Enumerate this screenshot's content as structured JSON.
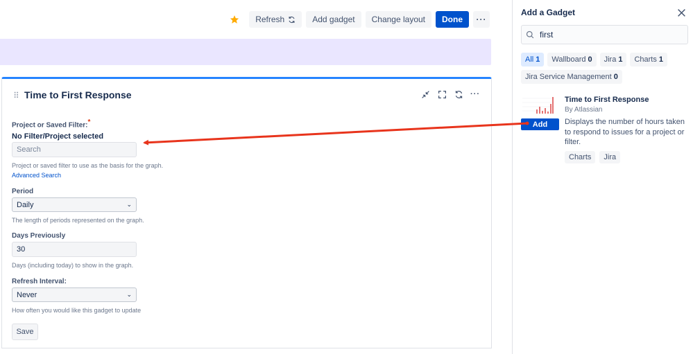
{
  "toolbar": {
    "refresh_label": "Refresh",
    "add_gadget_label": "Add gadget",
    "change_layout_label": "Change layout",
    "done_label": "Done",
    "more_label": "···"
  },
  "gadget": {
    "title": "Time to First Response",
    "form": {
      "project_label": "Project or Saved Filter:",
      "required_mark": "*",
      "no_filter_text": "No Filter/Project selected",
      "search_placeholder": "Search",
      "project_help": "Project or saved filter to use as the basis for the graph.",
      "advanced_search_link": "Advanced Search",
      "period_label": "Period",
      "period_value": "Daily",
      "period_help": "The length of periods represented on the graph.",
      "days_label": "Days Previously",
      "days_value": "30",
      "days_help": "Days (including today) to show in the graph.",
      "refresh_label": "Refresh Interval:",
      "refresh_value": "Never",
      "refresh_help": "How often you would like this gadget to update",
      "save_label": "Save"
    }
  },
  "panel": {
    "title": "Add a Gadget",
    "search_value": "first",
    "filters": [
      {
        "label": "All",
        "count": "1",
        "active": true
      },
      {
        "label": "Wallboard",
        "count": "0",
        "active": false
      },
      {
        "label": "Jira",
        "count": "1",
        "active": false
      },
      {
        "label": "Charts",
        "count": "1",
        "active": false
      },
      {
        "label": "Jira Service Management",
        "count": "0",
        "active": false
      }
    ],
    "result": {
      "title": "Time to First Response",
      "author": "By Atlassian",
      "description": "Displays the number of hours taken to respond to issues for a project or filter.",
      "add_label": "Add",
      "tags": [
        "Charts",
        "Jira"
      ]
    }
  },
  "colors": {
    "accent": "#0052cc",
    "banner": "#eae6ff",
    "gadget_border_top": "#2684ff",
    "star": "#ffab00",
    "annotation_arrow": "#e8341c"
  },
  "icons": [
    "star-icon",
    "refresh-icon",
    "drag-handle-icon",
    "minimize-icon",
    "fullscreen-icon",
    "more-icon",
    "search-icon",
    "close-icon",
    "chevron-down-icon"
  ]
}
